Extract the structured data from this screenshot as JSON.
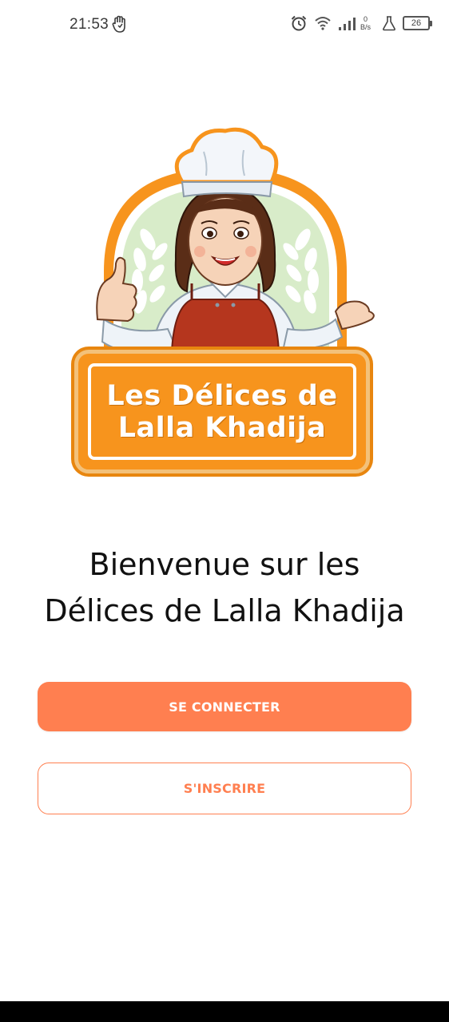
{
  "status_bar": {
    "time": "21:53",
    "left_icon": "hand-shield-icon",
    "icons": [
      "alarm-icon",
      "wifi-icon",
      "signal-icon",
      "flask-icon"
    ],
    "net_speed_value": "0",
    "net_speed_unit": "B/s",
    "battery_level": "26"
  },
  "logo": {
    "line1": "Les Délices de",
    "line2": "Lalla Khadija",
    "colors": {
      "orange": "#f7941d",
      "apron": "#b5361e",
      "hat": "#f3f6fa",
      "laurel_bg": "#d8ecc9"
    }
  },
  "welcome": {
    "line1": "Bienvenue sur les",
    "line2": "Délices de Lalla Khadija"
  },
  "buttons": {
    "login_label": "SE CONNECTER",
    "signup_label": "S'INSCRIRE"
  },
  "accent_color": "#ff7f50"
}
